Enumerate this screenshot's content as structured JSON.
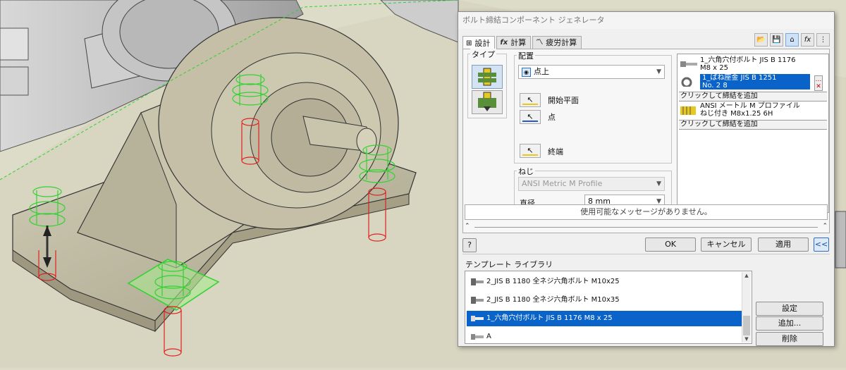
{
  "dialog": {
    "title": "ボルト締結コンポーネント ジェネレータ",
    "tabs": [
      {
        "label": "設計",
        "icon": "design-icon",
        "active": true
      },
      {
        "label": "計算",
        "icon": "fx-calculation-icon",
        "active": false
      },
      {
        "label": "疲労計算",
        "icon": "fatigue-calculation-icon",
        "active": false
      }
    ],
    "toolbar_icons": [
      "open-folder-icon",
      "save-icon",
      "design-mode-icon",
      "fx-icon",
      "options-icon"
    ]
  },
  "type_group": {
    "label": "タイプ"
  },
  "placement": {
    "label": "配置",
    "selected": "点上",
    "start_plane_label": "開始平面",
    "point_label": "点",
    "termination_label": "終端"
  },
  "thread": {
    "label": "ねじ",
    "standard": "ANSI Metric M Profile",
    "diameter_label": "直径",
    "diameter_value": "8 mm"
  },
  "components": [
    {
      "line1": "1_六角穴付ボルト JIS B 1176",
      "line2": "M8 x 25",
      "selected": false,
      "icon": "bolt-icon"
    },
    {
      "line1": "1_ばね座金 JIS B 1251",
      "line2": "No. 2 8",
      "selected": true,
      "icon": "spring-washer-icon"
    },
    {
      "add": "クリックして締結を追加"
    },
    {
      "line1": "ANSI メートル M プロファイル",
      "line2": "ねじ付き M8x1.25 6H",
      "selected": false,
      "icon": "thread-hole-icon"
    },
    {
      "add": "クリックして締結を追加"
    }
  ],
  "message": "使用可能なメッセージがありません。",
  "buttons": {
    "ok": "OK",
    "cancel": "キャンセル",
    "apply": "適用",
    "collapse": "<<"
  },
  "template_library": {
    "label": "テンプレート ライブラリ",
    "items": [
      {
        "label": "2_JIS B 1180 全ネジ六角ボルト M10x25",
        "selected": false
      },
      {
        "label": "2_JIS B 1180 全ネジ六角ボルト M10x35",
        "selected": false
      },
      {
        "label": "1_六角穴付ボルト JIS B 1176 M8 x 25",
        "selected": true
      },
      {
        "label": "A",
        "selected": false
      }
    ],
    "settings_label": "設定",
    "add_label": "追加...",
    "delete_label": "削除"
  },
  "colors": {
    "selection": "#0a63c8",
    "viewport_bg": "#dcdcc8",
    "green_preview": "#32d232",
    "red_preview": "#e02020"
  }
}
